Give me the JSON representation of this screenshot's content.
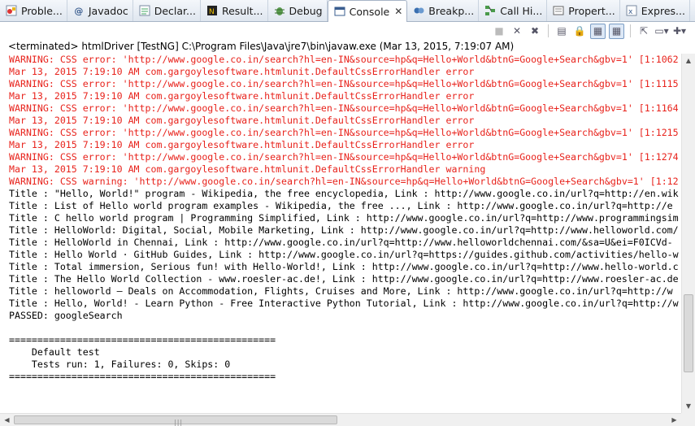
{
  "tabs": [
    {
      "label": "Proble...",
      "icon": "problems-icon",
      "active": false
    },
    {
      "label": "Javadoc",
      "icon": "javadoc-icon",
      "active": false
    },
    {
      "label": "Declar...",
      "icon": "declaration-icon",
      "active": false
    },
    {
      "label": "Result...",
      "icon": "testng-results-icon",
      "active": false
    },
    {
      "label": "Debug",
      "icon": "debug-icon",
      "active": false
    },
    {
      "label": "Console",
      "icon": "console-icon",
      "active": true
    },
    {
      "label": "Breakp...",
      "icon": "breakpoints-icon",
      "active": false
    },
    {
      "label": "Call Hi...",
      "icon": "call-hierarchy-icon",
      "active": false
    },
    {
      "label": "Propert...",
      "icon": "properties-icon",
      "active": false
    },
    {
      "label": "Expres...",
      "icon": "expressions-icon",
      "active": false
    }
  ],
  "status": "<terminated> htmlDriver [TestNG] C:\\Program Files\\Java\\jre7\\bin\\javaw.exe (Mar 13, 2015, 7:19:07 AM)",
  "console_lines": [
    {
      "t": "WARNING: CSS error: 'http://www.google.co.in/search?hl=en-IN&source=hp&q=Hello+World&btnG=Google+Search&gbv=1' [1:1062",
      "k": "err"
    },
    {
      "t": "Mar 13, 2015 7:19:10 AM com.gargoylesoftware.htmlunit.DefaultCssErrorHandler error",
      "k": "err"
    },
    {
      "t": "WARNING: CSS error: 'http://www.google.co.in/search?hl=en-IN&source=hp&q=Hello+World&btnG=Google+Search&gbv=1' [1:1115",
      "k": "err"
    },
    {
      "t": "Mar 13, 2015 7:19:10 AM com.gargoylesoftware.htmlunit.DefaultCssErrorHandler error",
      "k": "err"
    },
    {
      "t": "WARNING: CSS error: 'http://www.google.co.in/search?hl=en-IN&source=hp&q=Hello+World&btnG=Google+Search&gbv=1' [1:1164",
      "k": "err"
    },
    {
      "t": "Mar 13, 2015 7:19:10 AM com.gargoylesoftware.htmlunit.DefaultCssErrorHandler error",
      "k": "err"
    },
    {
      "t": "WARNING: CSS error: 'http://www.google.co.in/search?hl=en-IN&source=hp&q=Hello+World&btnG=Google+Search&gbv=1' [1:1215",
      "k": "err"
    },
    {
      "t": "Mar 13, 2015 7:19:10 AM com.gargoylesoftware.htmlunit.DefaultCssErrorHandler error",
      "k": "err"
    },
    {
      "t": "WARNING: CSS error: 'http://www.google.co.in/search?hl=en-IN&source=hp&q=Hello+World&btnG=Google+Search&gbv=1' [1:1274",
      "k": "err"
    },
    {
      "t": "Mar 13, 2015 7:19:10 AM com.gargoylesoftware.htmlunit.DefaultCssErrorHandler warning",
      "k": "err"
    },
    {
      "t": "WARNING: CSS warning: 'http://www.google.co.in/search?hl=en-IN&source=hp&q=Hello+World&btnG=Google+Search&gbv=1' [1:12",
      "k": "err"
    },
    {
      "t": "Title : \"Hello, World!\" program - Wikipedia, the free encyclopedia, Link : http://www.google.co.in/url?q=http://en.wik",
      "k": "out"
    },
    {
      "t": "Title : List of Hello world program examples - Wikipedia, the free ..., Link : http://www.google.co.in/url?q=http://e",
      "k": "out"
    },
    {
      "t": "Title : C hello world program | Programming Simplified, Link : http://www.google.co.in/url?q=http://www.programmingsim",
      "k": "out"
    },
    {
      "t": "Title : HelloWorld: Digital, Social, Mobile Marketing, Link : http://www.google.co.in/url?q=http://www.helloworld.com/",
      "k": "out"
    },
    {
      "t": "Title : HelloWorld in Chennai, Link : http://www.google.co.in/url?q=http://www.helloworldchennai.com/&sa=U&ei=F0ICVd-",
      "k": "out"
    },
    {
      "t": "Title : Hello World · GitHub Guides, Link : http://www.google.co.in/url?q=https://guides.github.com/activities/hello-w",
      "k": "out"
    },
    {
      "t": "Title : Total immersion, Serious fun! with Hello-World!, Link : http://www.google.co.in/url?q=http://www.hello-world.c",
      "k": "out"
    },
    {
      "t": "Title : The Hello World Collection - www.roesler-ac.de!, Link : http://www.google.co.in/url?q=http://www.roesler-ac.de",
      "k": "out"
    },
    {
      "t": "Title : helloworld – Deals on Accommodation, Flights, Cruises and More, Link : http://www.google.co.in/url?q=http://w",
      "k": "out"
    },
    {
      "t": "Title : Hello, World! - Learn Python - Free Interactive Python Tutorial, Link : http://www.google.co.in/url?q=http://w",
      "k": "out"
    },
    {
      "t": "PASSED: googleSearch",
      "k": "out"
    },
    {
      "t": "",
      "k": "out"
    },
    {
      "t": "===============================================",
      "k": "out"
    },
    {
      "t": "    Default test",
      "k": "out"
    },
    {
      "t": "    Tests run: 1, Failures: 0, Skips: 0",
      "k": "out"
    },
    {
      "t": "===============================================",
      "k": "out"
    }
  ],
  "colors": {
    "error": "#e8231c",
    "output": "#000000"
  }
}
